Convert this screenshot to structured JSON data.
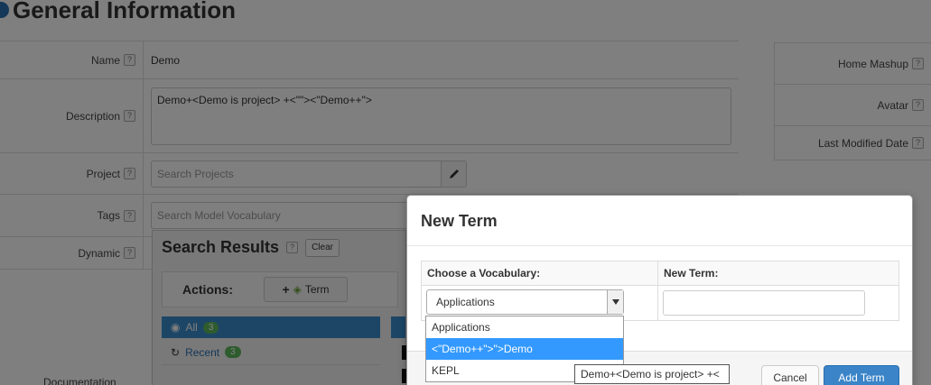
{
  "page": {
    "title": "General Information"
  },
  "form": {
    "name_label": "Name",
    "name_value": "Demo",
    "description_label": "Description",
    "description_value": "Demo+<Demo is project> +<\"\"><\"Demo++\">",
    "project_label": "Project",
    "project_placeholder": "Search Projects",
    "tags_label": "Tags",
    "tags_placeholder": "Search Model Vocabulary",
    "dynamic_label": "Dynamic",
    "documentation_label": "Documentation",
    "help_glyph": "?"
  },
  "right_panel": {
    "home_mashup_label": "Home Mashup",
    "avatar_label": "Avatar",
    "last_modified_label": "Last Modified Date"
  },
  "search_results": {
    "title": "Search Results",
    "clear_label": "Clear",
    "actions_label": "Actions:",
    "term_button_label": "Term",
    "all_label": "All",
    "all_count": "3",
    "recent_label": "Recent",
    "recent_count": "3"
  },
  "modal": {
    "title": "New Term",
    "col_vocabulary": "Choose a Vocabulary:",
    "col_new_term": "New Term:",
    "selected_vocabulary": "Applications",
    "new_term_value": "",
    "cancel_label": "Cancel",
    "add_label": "Add Term"
  },
  "dropdown": {
    "options": [
      "Applications",
      "<\"Demo++\">\">Demo",
      "KEPL"
    ],
    "highlighted_index": 1
  },
  "tooltip": {
    "text": "Demo+<Demo is project> +<"
  },
  "colors": {
    "accent": "#3a84c7",
    "highlight": "#3399ff",
    "badge": "#5cb85c"
  }
}
